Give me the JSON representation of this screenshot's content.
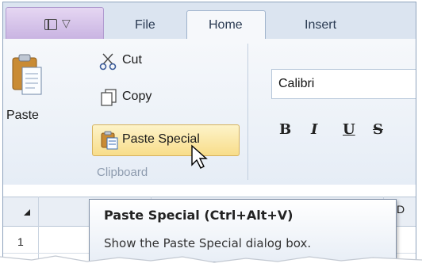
{
  "tabs": {
    "file": "File",
    "home": "Home",
    "insert": "Insert"
  },
  "clipboard": {
    "paste": "Paste",
    "cut": "Cut",
    "copy": "Copy",
    "paste_special": "Paste Special",
    "group_label": "Clipboard"
  },
  "font": {
    "name": "Calibri",
    "bold": "B",
    "italic": "I",
    "underline": "U",
    "strike": "S"
  },
  "grid": {
    "column_d": "D",
    "row_1": "1"
  },
  "tooltip": {
    "title": "Paste Special (Ctrl+Alt+V)",
    "description": "Show the Paste Special dialog box."
  },
  "icons": [
    "quick-access-icon",
    "paste-icon",
    "cut-icon",
    "copy-icon",
    "paste-special-icon",
    "mouse-pointer-icon",
    "select-all-icon"
  ]
}
